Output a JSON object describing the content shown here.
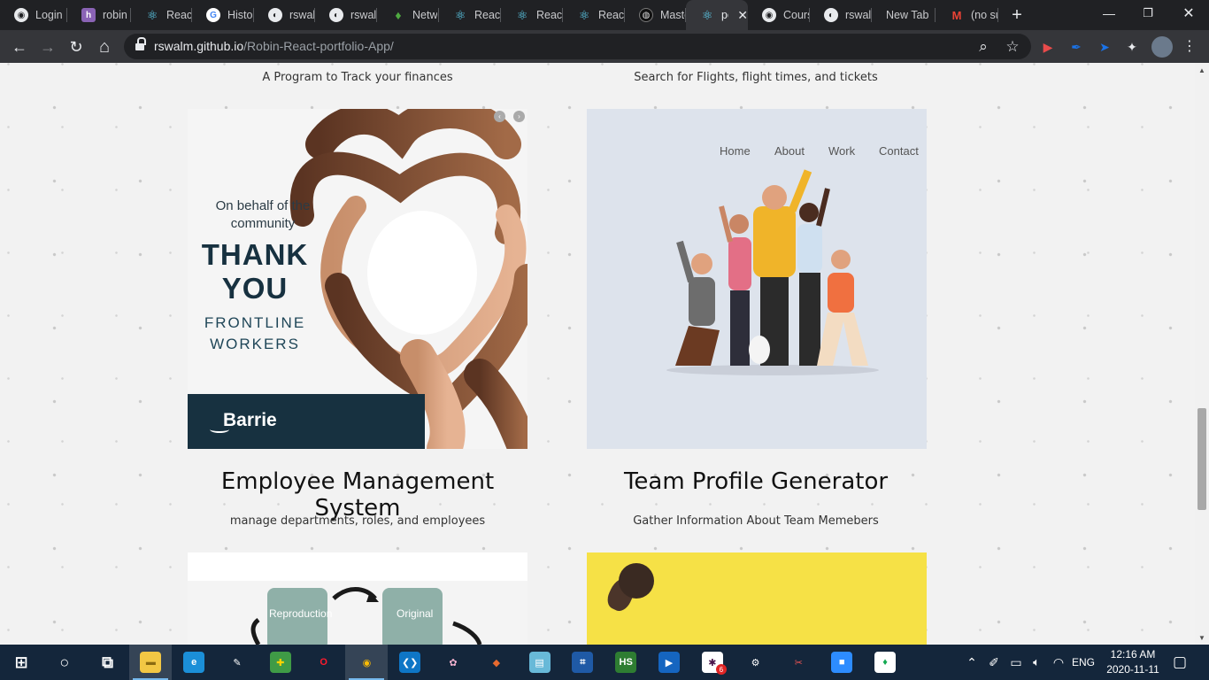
{
  "browser": {
    "tabs": [
      {
        "label": "Login",
        "icon": "globe-icon",
        "fav": "fav-globe",
        "glyph": "◉",
        "width": 76
      },
      {
        "label": "robin",
        "icon": "heroku-icon",
        "fav": "fav-h",
        "glyph": "h",
        "width": 72
      },
      {
        "label": "React",
        "icon": "react-icon",
        "fav": "fav-react",
        "glyph": "⚛",
        "width": 69
      },
      {
        "label": "Histor",
        "icon": "google-icon",
        "fav": "fav-google",
        "glyph": "G",
        "width": 70
      },
      {
        "label": "rswalr",
        "icon": "github-icon",
        "fav": "fav-gh",
        "glyph": "◐",
        "width": 69
      },
      {
        "label": "rswalr",
        "icon": "github-icon",
        "fav": "fav-gh",
        "glyph": "◐",
        "width": 70
      },
      {
        "label": "Netw",
        "icon": "mongodb-leaf-icon",
        "fav": "fav-mongo",
        "glyph": "♦",
        "width": 70
      },
      {
        "label": "React",
        "icon": "react-icon",
        "fav": "fav-react",
        "glyph": "⚛",
        "width": 70
      },
      {
        "label": "React",
        "icon": "react-icon",
        "fav": "fav-react",
        "glyph": "⚛",
        "width": 70
      },
      {
        "label": "React",
        "icon": "react-icon",
        "fav": "fav-react",
        "glyph": "⚛",
        "width": 70
      },
      {
        "label": "Maste",
        "icon": "master-icon",
        "fav": "fav-master",
        "glyph": "◍",
        "width": 69
      },
      {
        "label": "pc",
        "icon": "react-icon",
        "fav": "fav-react",
        "glyph": "⚛",
        "width": 70,
        "active": true
      },
      {
        "label": "Cours",
        "icon": "globe-icon",
        "fav": "fav-globe",
        "glyph": "◉",
        "width": 70
      },
      {
        "label": "rswalr",
        "icon": "github-icon",
        "fav": "fav-gh",
        "glyph": "◐",
        "width": 70
      },
      {
        "label": "New Tab",
        "icon": "",
        "fav": "",
        "glyph": "",
        "width": 72
      },
      {
        "label": "(no su",
        "icon": "gmail-icon",
        "fav": "fav-gmail",
        "glyph": "M",
        "width": 71
      }
    ],
    "close_glyph": "✕",
    "new_tab_glyph": "+",
    "window_controls": {
      "minimize": "—",
      "restore": "❐",
      "close": "✕"
    },
    "nav": {
      "back": "←",
      "forward": "→",
      "reload": "↻",
      "home": "⌂"
    },
    "url_host": "rswalm.github.io",
    "url_path": "/Robin-React-portfolio-App/",
    "omnibox_icons": {
      "zoom": "⌕",
      "star": "☆"
    },
    "extensions": [
      {
        "name": "youtube-ext-icon",
        "glyph": "▶",
        "color": "#e94b4b"
      },
      {
        "name": "pen-ext-icon",
        "glyph": "✒",
        "color": "#1a73e8"
      },
      {
        "name": "send-ext-icon",
        "glyph": "➤",
        "color": "#1a73e8"
      },
      {
        "name": "puzzle-extensions-icon",
        "glyph": "✦",
        "color": "#e8eaed"
      }
    ]
  },
  "page": {
    "top_left_subtitle": "A Program to Track your finances",
    "top_right_subtitle": "Search for Flights, flight times, and tickets",
    "cards": [
      {
        "title": "Employee Management System",
        "subtitle": "manage departments, roles, and employees"
      },
      {
        "title": "Team Profile Generator",
        "subtitle": "Gather Information About Team Memebers"
      }
    ],
    "thank_you_image": {
      "line1": "On behalf of the community",
      "line2": "THANK YOU",
      "line3": "FRONTLINE WORKERS",
      "brand": "Barrie",
      "arrows": [
        "‹",
        "›"
      ]
    },
    "team_image_nav": [
      "Home",
      "About",
      "Work",
      "Contact"
    ],
    "repro_image": {
      "left_label": "Reproduction",
      "right_label": "Original"
    },
    "scroll": {
      "up": "▲",
      "down": "▼"
    }
  },
  "taskbar": {
    "apps": [
      {
        "name": "windows-start-icon",
        "glyph": "⊞",
        "bg": "transparent",
        "color": "#fff"
      },
      {
        "name": "cortana-search-icon",
        "glyph": "○",
        "bg": "transparent",
        "color": "#fff"
      },
      {
        "name": "task-view-icon",
        "glyph": "⧉",
        "bg": "transparent",
        "color": "#fff"
      },
      {
        "name": "file-explorer-icon",
        "glyph": "▬",
        "bg": "#f2c744",
        "color": "#8a6a10",
        "active": true
      },
      {
        "name": "edge-icon",
        "glyph": "e",
        "bg": "#1b8fd8",
        "color": "#fff"
      },
      {
        "name": "sticky-pen-icon",
        "glyph": "✎",
        "bg": "transparent",
        "color": "#fff"
      },
      {
        "name": "sketch-app-icon",
        "glyph": "✚",
        "bg": "#3f9b46",
        "color": "#ffd400"
      },
      {
        "name": "opera-icon",
        "glyph": "O",
        "bg": "transparent",
        "color": "#ff1b2d"
      },
      {
        "name": "chrome-icon",
        "glyph": "◉",
        "bg": "transparent",
        "color": "#fbbc05",
        "active": true
      },
      {
        "name": "vscode-icon",
        "glyph": "❮❯",
        "bg": "#0e76c6",
        "color": "#fff"
      },
      {
        "name": "paint-icon",
        "glyph": "✿",
        "bg": "transparent",
        "color": "#f5b3d0"
      },
      {
        "name": "git-kraken-icon",
        "glyph": "◆",
        "bg": "transparent",
        "color": "#e86a2f"
      },
      {
        "name": "notepad-icon",
        "glyph": "▤",
        "bg": "#68b9d8",
        "color": "#fff"
      },
      {
        "name": "network-app-icon",
        "glyph": "⌗",
        "bg": "#1f5aa6",
        "color": "#fff"
      },
      {
        "name": "hs-app-icon",
        "glyph": "HS",
        "bg": "#2e7d32",
        "color": "#fff"
      },
      {
        "name": "media-player-icon",
        "glyph": "▶",
        "bg": "#1565c0",
        "color": "#fff"
      },
      {
        "name": "slack-icon",
        "glyph": "✱",
        "bg": "#fff",
        "color": "#4a154b"
      },
      {
        "name": "settings-icon",
        "glyph": "⚙",
        "bg": "transparent",
        "color": "#fff"
      },
      {
        "name": "snipping-tool-icon",
        "glyph": "✂",
        "bg": "transparent",
        "color": "#f05454"
      },
      {
        "name": "zoom-icon",
        "glyph": "■",
        "bg": "#2d8cff",
        "color": "#fff"
      },
      {
        "name": "mongodb-compass-icon",
        "glyph": "♦",
        "bg": "#fff",
        "color": "#13aa52"
      }
    ],
    "slack_badge": "6",
    "tray_icons": [
      {
        "name": "chevron-up-icon",
        "glyph": "⌃"
      },
      {
        "name": "pen-tray-icon",
        "glyph": "✐"
      },
      {
        "name": "battery-icon",
        "glyph": "▭"
      },
      {
        "name": "volume-icon",
        "glyph": "🔈︎"
      },
      {
        "name": "wifi-icon",
        "glyph": "◠"
      }
    ],
    "language": "ENG",
    "time": "12:16 AM",
    "date": "2020-11-11",
    "notification_glyph": "▢"
  }
}
